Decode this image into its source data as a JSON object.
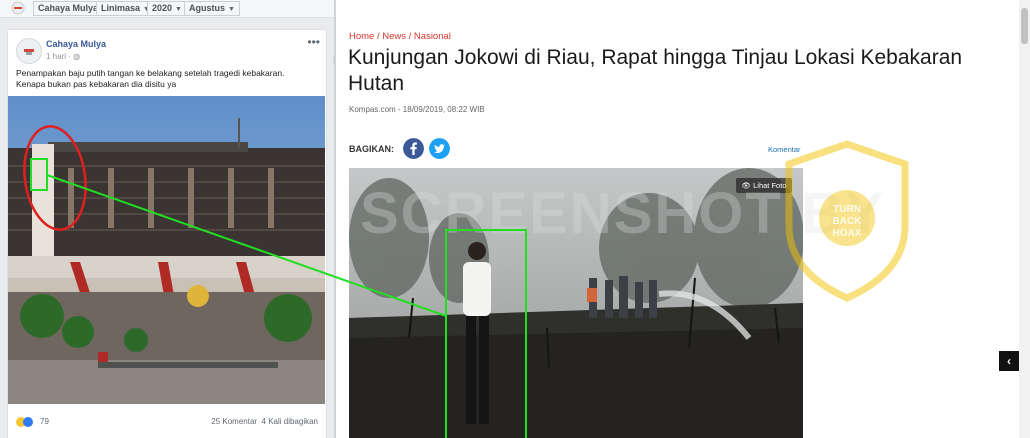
{
  "facebook": {
    "filters": [
      {
        "label": "Cahaya Mulya"
      },
      {
        "label": "Linimasa"
      },
      {
        "label": "2020"
      },
      {
        "label": "Agustus"
      }
    ],
    "post": {
      "page_name": "Cahaya Mulya",
      "time": "1 hari",
      "caption_line1": "Penampakan baju putih tangan ke belakang setelah tragedi kebakaran.",
      "caption_line2": "Kenapa bukan pas kebakaran dia disitu ya",
      "reaction_count": "79",
      "comments": "25 Komentar",
      "shares": "4 Kali dibagikan"
    }
  },
  "article": {
    "breadcrumb": "Home / News / Nasional",
    "title": "Kunjungan Jokowi di Riau, Rapat hingga Tinjau Lokasi Kebakaran Hutan",
    "meta": "Kompas.com - 18/09/2019, 08:22 WIB",
    "share_label": "BAGIKAN:",
    "comment_link": "Komentar",
    "photo_button": "Lihat Foto"
  },
  "watermark": {
    "text": "SCREENSHOT BY",
    "logo_top": "MASYARAKAT ANTI FITNAH INDONESIA",
    "logo_center": "TURN BACK HOAX",
    "logo_bottom": "MAFINDO"
  },
  "annotation": {
    "color": "#22dd22",
    "circle_color": "#e02020"
  },
  "colors": {
    "fb_link": "#385898",
    "breadcrumb": "#d5372b",
    "facebook": "#3b5998",
    "twitter": "#1da1f2",
    "watermark_logo": "#f2c200"
  }
}
